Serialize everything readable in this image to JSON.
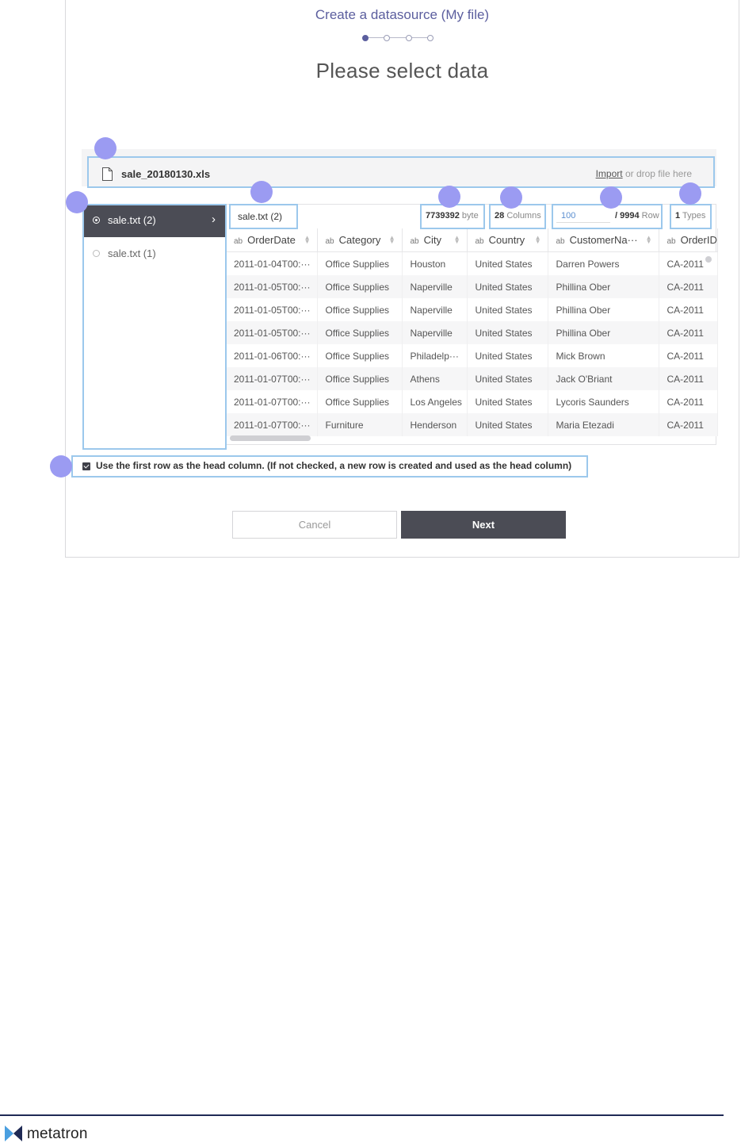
{
  "wizard": {
    "title": "Create a datasource (My file)",
    "step_count": 4,
    "current_step": 1,
    "page_title": "Please select data"
  },
  "upload": {
    "file_name": "sale_20180130.xls",
    "import_link": "Import",
    "drop_hint": " or drop file here"
  },
  "sheets": [
    {
      "label": "sale.txt (2)",
      "selected": true
    },
    {
      "label": "sale.txt (1)",
      "selected": false
    }
  ],
  "grid_info": {
    "sheet_name": "sale.txt (2)",
    "bytes_value": "7739392",
    "bytes_unit": "byte",
    "columns_value": "28",
    "columns_unit": "Columns",
    "rows_input": "100",
    "rows_total": "/ 9994",
    "rows_unit": "Row",
    "types_value": "1",
    "types_unit": "Types"
  },
  "table": {
    "type_prefix": "ab",
    "columns": [
      "OrderDate",
      "Category",
      "City",
      "Country",
      "CustomerNa···",
      "OrderID"
    ],
    "rows": [
      [
        "2011-01-04T00:···",
        "Office Supplies",
        "Houston",
        "United States",
        "Darren Powers",
        "CA-2011"
      ],
      [
        "2011-01-05T00:···",
        "Office Supplies",
        "Naperville",
        "United States",
        "Phillina Ober",
        "CA-2011"
      ],
      [
        "2011-01-05T00:···",
        "Office Supplies",
        "Naperville",
        "United States",
        "Phillina Ober",
        "CA-2011"
      ],
      [
        "2011-01-05T00:···",
        "Office Supplies",
        "Naperville",
        "United States",
        "Phillina Ober",
        "CA-2011"
      ],
      [
        "2011-01-06T00:···",
        "Office Supplies",
        "Philadelp···",
        "United States",
        "Mick Brown",
        "CA-2011"
      ],
      [
        "2011-01-07T00:···",
        "Office Supplies",
        "Athens",
        "United States",
        "Jack O'Briant",
        "CA-2011"
      ],
      [
        "2011-01-07T00:···",
        "Office Supplies",
        "Los Angeles",
        "United States",
        "Lycoris Saunders",
        "CA-2011"
      ],
      [
        "2011-01-07T00:···",
        "Furniture",
        "Henderson",
        "United States",
        "Maria Etezadi",
        "CA-2011"
      ]
    ]
  },
  "options": {
    "first_row_header_checked": true,
    "first_row_header_label": "Use the first row as the head column. (If not checked, a new row is created and used as the head column)"
  },
  "buttons": {
    "cancel": "Cancel",
    "next": "Next"
  },
  "footer": {
    "brand": "metatron"
  },
  "colors": {
    "accent": "#5b5e9e",
    "highlight_box": "#9cc8ec",
    "callout_marker": "#9b9bf2",
    "dark_button": "#4b4c55",
    "footer_line": "#1f2a55"
  }
}
